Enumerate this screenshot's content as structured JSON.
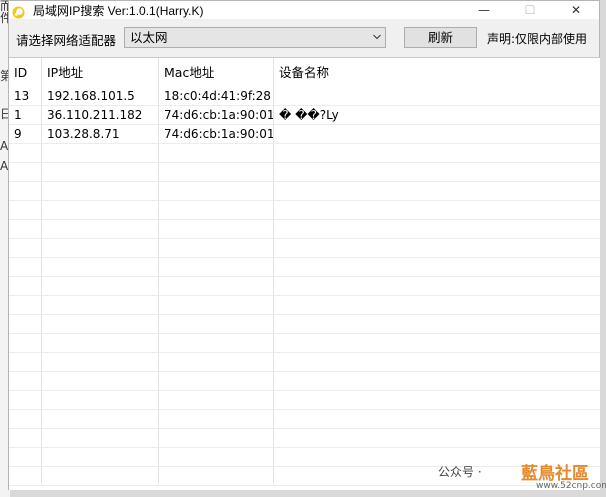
{
  "window": {
    "title": "局域网IP搜索 Ver:1.0.1(Harry.K)",
    "controls": {
      "minimize": "—",
      "maximize": "☐",
      "close": "✕"
    }
  },
  "toolbar": {
    "adapter_label": "请选择网络适配器",
    "adapter_selected": "以太网",
    "refresh_label": "刷新",
    "notice": "声明:仅限内部使用"
  },
  "table": {
    "columns": [
      "ID",
      "IP地址",
      "Mac地址",
      "设备名称"
    ],
    "rows": [
      [
        "13",
        "192.168.101.5",
        "18:c0:4d:41:9f:28",
        ""
      ],
      [
        "1",
        "36.110.211.182",
        "74:d6:cb:1a:90:01",
        "� ��?Ly"
      ],
      [
        "9",
        "103.28.8.71",
        "74:d6:cb:1a:90:01",
        ""
      ]
    ]
  },
  "background_chars": [
    "而",
    "件",
    "",
    "",
    "",
    "",
    "第",
    "",
    "日",
    "",
    "A/",
    "",
    "A/"
  ],
  "watermark": {
    "text": "公众号 ·",
    "logo": "藍鳥社區",
    "site": "www.52cnp.com"
  },
  "colors": {
    "window_bg": "#f0f0f0",
    "list_bg": "#ffffff",
    "grid": "#e3e3e3",
    "accent_logo": "#e58a2c"
  }
}
